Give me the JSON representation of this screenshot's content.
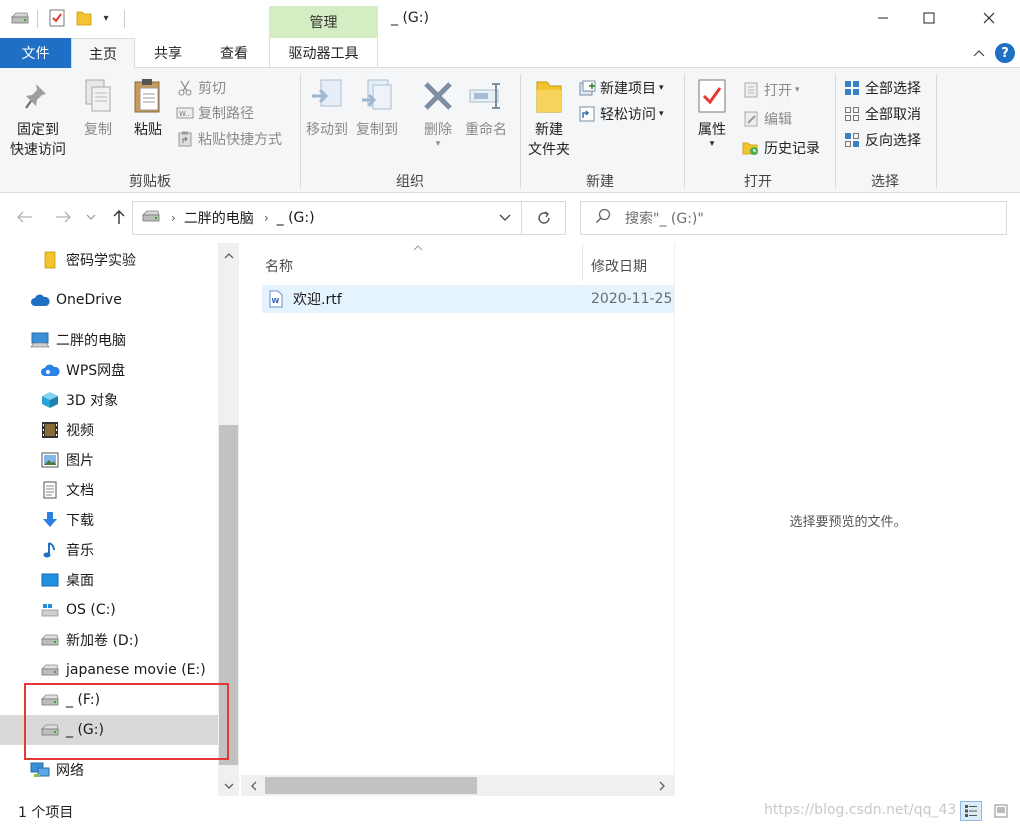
{
  "titlebar": {
    "manage_tab": "管理",
    "window_title": "_ (G:)"
  },
  "ribbon_tabs": {
    "file": "文件",
    "home": "主页",
    "share": "共享",
    "view": "查看",
    "drive_tools": "驱动器工具"
  },
  "help_label": "?",
  "ribbon": {
    "clipboard": {
      "label": "剪贴板",
      "pin_line1": "固定到",
      "pin_line2": "快速访问",
      "copy": "复制",
      "paste": "粘贴",
      "cut": "剪切",
      "copy_path": "复制路径",
      "paste_shortcut": "粘贴快捷方式"
    },
    "organize": {
      "label": "组织",
      "move_to": "移动到",
      "copy_to": "复制到",
      "delete": "删除",
      "rename": "重命名"
    },
    "new": {
      "label": "新建",
      "new_folder_line1": "新建",
      "new_folder_line2": "文件夹",
      "new_item": "新建项目",
      "easy_access": "轻松访问"
    },
    "open": {
      "label": "打开",
      "properties": "属性",
      "open": "打开",
      "edit": "编辑",
      "history": "历史记录"
    },
    "select": {
      "label": "选择",
      "select_all": "全部选择",
      "select_none": "全部取消",
      "invert": "反向选择"
    }
  },
  "address": {
    "crumbs": [
      "二胖的电脑",
      "_ (G:)"
    ]
  },
  "search": {
    "placeholder": "搜索\"_ (G:)\""
  },
  "nav_pane": {
    "items": [
      {
        "label": "密码学实验",
        "icon": "folder-icon"
      },
      {
        "label": "OneDrive",
        "icon": "cloud-icon"
      },
      {
        "label": "二胖的电脑",
        "icon": "computer-icon"
      },
      {
        "label": "WPS网盘",
        "icon": "wps-cloud-icon"
      },
      {
        "label": "3D 对象",
        "icon": "cube-icon"
      },
      {
        "label": "视频",
        "icon": "video-icon"
      },
      {
        "label": "图片",
        "icon": "picture-icon"
      },
      {
        "label": "文档",
        "icon": "document-icon"
      },
      {
        "label": "下载",
        "icon": "download-icon"
      },
      {
        "label": "音乐",
        "icon": "music-icon"
      },
      {
        "label": "桌面",
        "icon": "desktop-icon"
      },
      {
        "label": "OS (C:)",
        "icon": "windows-drive-icon"
      },
      {
        "label": "新加卷 (D:)",
        "icon": "drive-icon"
      },
      {
        "label": "japanese movie (E:)",
        "icon": "drive-icon"
      },
      {
        "label": "_ (F:)",
        "icon": "drive-icon"
      },
      {
        "label": "_ (G:)",
        "icon": "drive-icon"
      },
      {
        "label": "网络",
        "icon": "network-icon"
      }
    ]
  },
  "file_list": {
    "columns": {
      "name": "名称",
      "date": "修改日期"
    },
    "rows": [
      {
        "name": "欢迎.rtf",
        "date": "2020-11-25"
      }
    ]
  },
  "preview": {
    "empty_text": "选择要预览的文件。"
  },
  "status": {
    "count": "1 个项目",
    "watermark": "https://blog.csdn.net/qq_43"
  },
  "colors": {
    "file_tab": "#1f6fc5",
    "manage_tab": "#d4edc2",
    "selection": "#e5f3ff",
    "highlight_box": "#e53935"
  }
}
